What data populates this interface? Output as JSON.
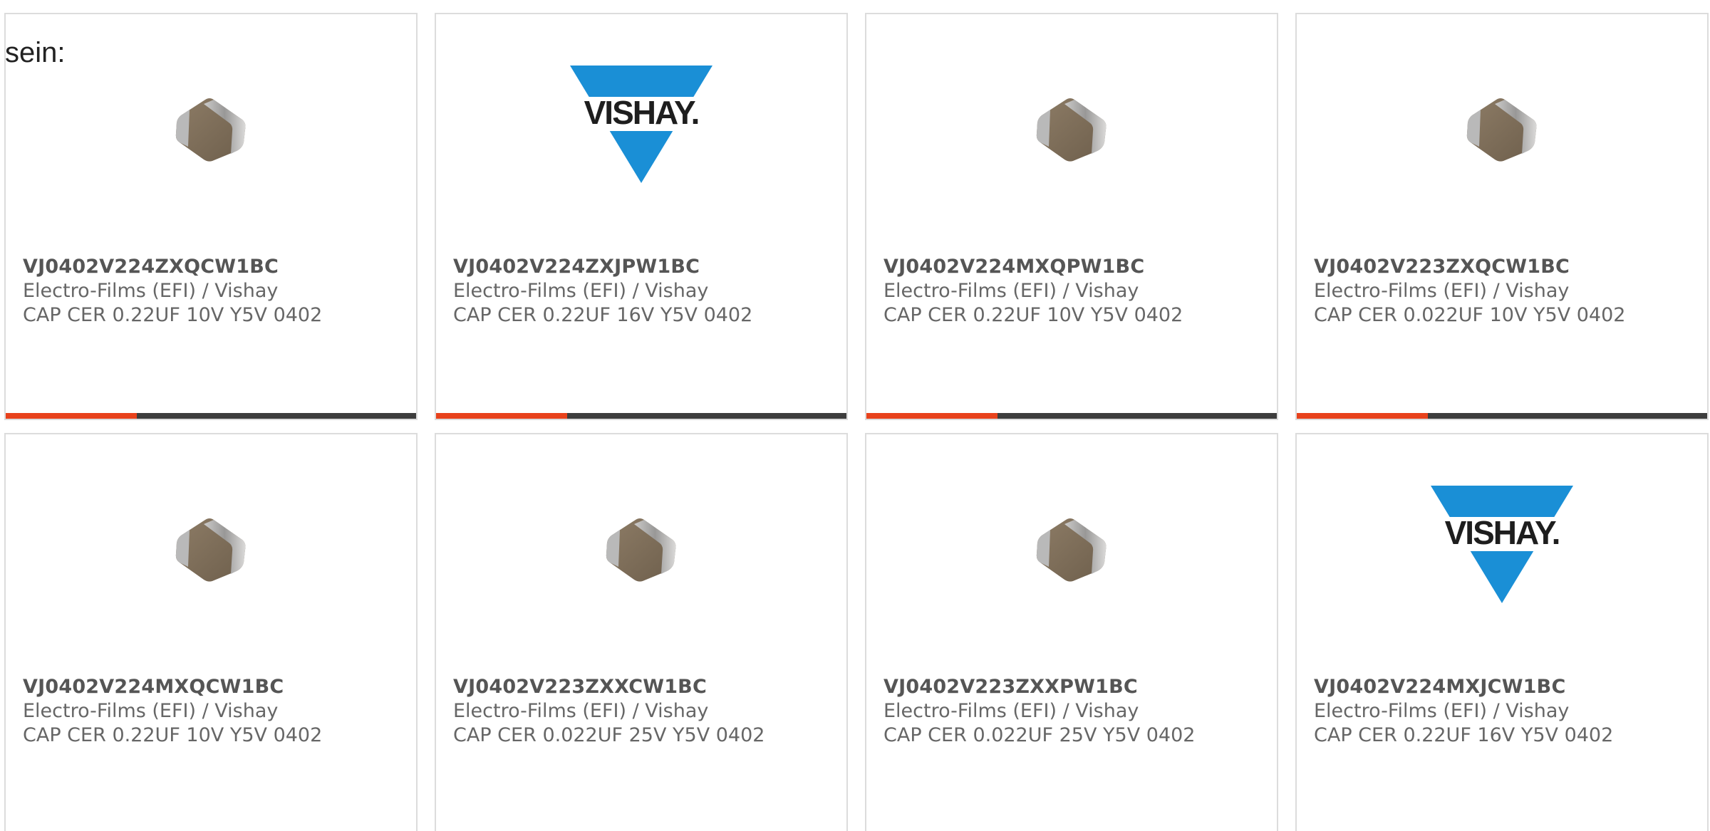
{
  "intro_text": "sein:",
  "colors": {
    "accent": "#e8421c",
    "bar_track": "#3d3d3d",
    "card_border": "#dcdcdc",
    "vishay_blue": "#1a8fd6",
    "chip_body": "#7a6a56"
  },
  "products": [
    {
      "part_number": "VJ0402V224ZXQCW1BC",
      "manufacturer": "Electro-Films (EFI) / Vishay",
      "description": "CAP CER 0.22UF 10V Y5V 0402",
      "image": "capacitor-chip-icon",
      "progress": 0.32
    },
    {
      "part_number": "VJ0402V224ZXJPW1BC",
      "manufacturer": "Electro-Films (EFI) / Vishay",
      "description": "CAP CER 0.22UF 16V Y5V 0402",
      "image": "vishay-logo",
      "logo_text": "VISHAY.",
      "progress": 0.32
    },
    {
      "part_number": "VJ0402V224MXQPW1BC",
      "manufacturer": "Electro-Films (EFI) / Vishay",
      "description": "CAP CER 0.22UF 10V Y5V 0402",
      "image": "capacitor-chip-icon",
      "progress": 0.32
    },
    {
      "part_number": "VJ0402V223ZXQCW1BC",
      "manufacturer": "Electro-Films (EFI) / Vishay",
      "description": "CAP CER 0.022UF 10V Y5V 0402",
      "image": "capacitor-chip-icon",
      "progress": 0.32
    },
    {
      "part_number": "VJ0402V224MXQCW1BC",
      "manufacturer": "Electro-Films (EFI) / Vishay",
      "description": "CAP CER 0.22UF 10V Y5V 0402",
      "image": "capacitor-chip-icon"
    },
    {
      "part_number": "VJ0402V223ZXXCW1BC",
      "manufacturer": "Electro-Films (EFI) / Vishay",
      "description": "CAP CER 0.022UF 25V Y5V 0402",
      "image": "capacitor-chip-icon"
    },
    {
      "part_number": "VJ0402V223ZXXPW1BC",
      "manufacturer": "Electro-Films (EFI) / Vishay",
      "description": "CAP CER 0.022UF 25V Y5V 0402",
      "image": "capacitor-chip-icon"
    },
    {
      "part_number": "VJ0402V224MXJCW1BC",
      "manufacturer": "Electro-Films (EFI) / Vishay",
      "description": "CAP CER 0.22UF 16V Y5V 0402",
      "image": "vishay-logo",
      "logo_text": "VISHAY.",
      "progress": null
    }
  ]
}
